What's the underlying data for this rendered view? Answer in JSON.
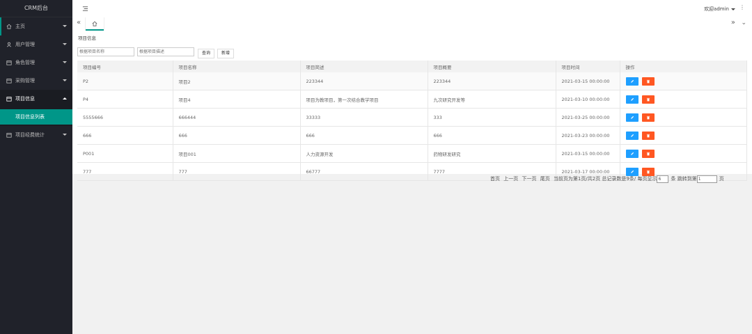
{
  "app": {
    "logo": "CRM后台"
  },
  "sidebar": {
    "items": [
      {
        "label": "主页",
        "icon": "home-icon"
      },
      {
        "label": "用户管理",
        "icon": "user-icon"
      },
      {
        "label": "角色管理",
        "icon": "folder-icon"
      },
      {
        "label": "采购管理",
        "icon": "folder-icon"
      },
      {
        "label": "项目信息",
        "icon": "folder-icon"
      },
      {
        "label": "项目经费统计",
        "icon": "folder-icon"
      }
    ],
    "sub_items": [
      {
        "label": "项目信息列表"
      }
    ]
  },
  "header": {
    "user": "欢迎admin",
    "more": "⋮"
  },
  "tabs": {
    "prev": "«",
    "next": "»",
    "down": "⌄"
  },
  "page": {
    "breadcrumb": "项目信息",
    "search_name_placeholder": "根据项目名称",
    "search_desc_placeholder": "根据项目描述",
    "query_label": "查询",
    "add_label": "新增"
  },
  "table": {
    "columns": [
      "项目编号",
      "项目名称",
      "项目简述",
      "项目概要",
      "项目时间",
      "操作"
    ],
    "rows": [
      {
        "id": "P2",
        "name": "项目2",
        "brief": "223344",
        "summary": "223344",
        "time": "2021-03-15 00:00:00"
      },
      {
        "id": "P4",
        "name": "项目4",
        "brief": "项目为教项目，第一次结合教学项目",
        "summary": "九次研究开发等",
        "time": "2021-03-10 00:00:00"
      },
      {
        "id": "5555666",
        "name": "666444",
        "brief": "33333",
        "summary": "333",
        "time": "2021-03-25 00:00:00"
      },
      {
        "id": "666",
        "name": "666",
        "brief": "666",
        "summary": "666",
        "time": "2021-03-23 00:00:00"
      },
      {
        "id": "P001",
        "name": "项目001",
        "brief": "人力资源开发",
        "summary": "药物研发研究",
        "time": "2021-03-15 00:00:00"
      },
      {
        "id": "777",
        "name": "777",
        "brief": "66777",
        "summary": "7777",
        "time": "2021-03-17 00:00:00"
      }
    ]
  },
  "pager": {
    "first": "首页",
    "prev": "上一页",
    "next": "下一页",
    "last": "尾页",
    "info": "当前页为第1页/共2页 总记录数是9条/ 每页显示",
    "page_size": "6",
    "unit": "条 跳转到第",
    "jump_value": "1",
    "end": "页"
  }
}
